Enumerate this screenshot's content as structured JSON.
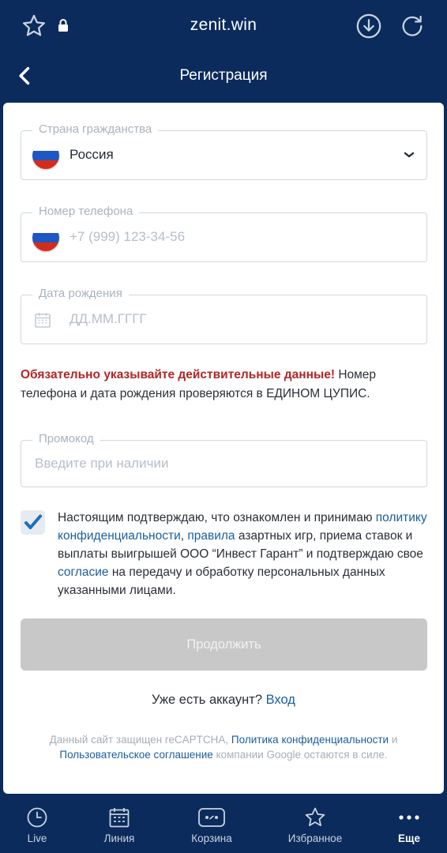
{
  "browser": {
    "url": "zenit.win",
    "icons": [
      "star-icon",
      "lock-icon",
      "download-icon",
      "reload-icon"
    ]
  },
  "header": {
    "title": "Регистрация",
    "back_icon": "chevron-left-icon"
  },
  "form": {
    "country": {
      "legend": "Страна гражданства",
      "value": "Россия",
      "flag": "russia-flag-icon"
    },
    "phone": {
      "legend": "Номер телефона",
      "placeholder": "+7 (999) 123-34-56"
    },
    "birthdate": {
      "legend": "Дата рождения",
      "placeholder": "ДД.ММ.ГГГГ"
    },
    "notice": {
      "warning": "Обязательно указывайте действительные данные!",
      "text": " Номер телефона и дата рождения проверяются в ЕДИНОМ ЦУПИС."
    },
    "promo": {
      "legend": "Промокод",
      "placeholder": "Введите при наличии"
    },
    "consent": {
      "checked": true,
      "part1": "Настоящим подтверждаю, что ознакомлен и принимаю ",
      "link_privacy": "политику конфиденциальности",
      "comma": ", ",
      "link_rules": "правила",
      "part2": " азартных игр, приема ставок и выплаты выигрышей ООО “Инвест Гарант” и подтверждаю свое ",
      "link_consent": "согласие",
      "part3": " на передачу и обработку персональных данных указанными лицами."
    },
    "continue_label": "Продолжить",
    "login_prompt": "Уже есть аккаунт?",
    "login_link": "Вход",
    "recaptcha": {
      "part1": "Данный сайт защищен reCAPTCHA, ",
      "link_privacy": "Политика конфиденциальности",
      "and": " и ",
      "link_terms": "Пользовательское соглашение",
      "part2": "  компании Google остаются в силе."
    }
  },
  "bottom_nav": {
    "items": [
      {
        "label": "Live",
        "icon": "clock-icon"
      },
      {
        "label": "Линия",
        "icon": "calendar-icon"
      },
      {
        "label": "Корзина",
        "icon": "bet-slip-icon"
      },
      {
        "label": "Избранное",
        "icon": "star-icon"
      },
      {
        "label": "Еще",
        "icon": "more-icon",
        "active": true
      }
    ]
  },
  "colors": {
    "header_bg": "#0b2b5c",
    "warning": "#b32626",
    "link": "#1a5e9e",
    "button_disabled": "#c8c8c8"
  }
}
